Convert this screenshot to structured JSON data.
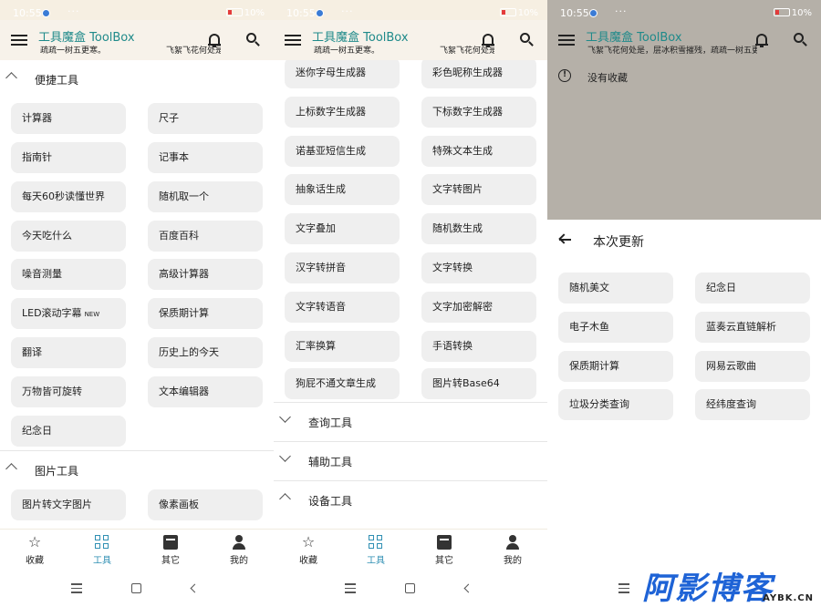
{
  "status": {
    "time": "10:55",
    "more": "···",
    "battery": "10%"
  },
  "app": {
    "title": "工具魔盒 ToolBox",
    "subtitle": "疏疏一树五更寒。",
    "subtitle2": "飞絮飞花何处是",
    "subtitle_overlay": "飞絮飞花何处是，层冰积雪摧残，疏疏一树五更寒"
  },
  "panel1": {
    "sections": [
      {
        "label": "便捷工具",
        "expanded": true,
        "items": [
          "计算器",
          "尺子",
          "指南针",
          "记事本",
          "每天60秒读懂世界",
          "随机取一个",
          "今天吃什么",
          "百度百科",
          "噪音测量",
          "高级计算器",
          "LED滚动字幕",
          "保质期计算",
          "翻译",
          "历史上的今天",
          "万物皆可旋转",
          "文本编辑器",
          "纪念日"
        ],
        "new_badge": "NEW"
      },
      {
        "label": "图片工具",
        "expanded": true,
        "items": [
          "图片转文字图片",
          "像素画板"
        ]
      }
    ]
  },
  "panel2": {
    "items": [
      "迷你字母生成器",
      "彩色昵称生成器",
      "上标数字生成器",
      "下标数字生成器",
      "诺基亚短信生成",
      "特殊文本生成",
      "抽象话生成",
      "文字转图片",
      "文字叠加",
      "随机数生成",
      "汉字转拼音",
      "文字转换",
      "文字转语音",
      "文字加密解密",
      "汇率换算",
      "手语转换",
      "狗屁不通文章生成",
      "图片转Base64"
    ],
    "sections": [
      {
        "label": "查询工具",
        "expanded": false
      },
      {
        "label": "辅助工具",
        "expanded": false
      },
      {
        "label": "设备工具",
        "expanded": true
      }
    ]
  },
  "nav": {
    "items": [
      {
        "label": "收藏",
        "icon": "star-icon",
        "active": false
      },
      {
        "label": "工具",
        "icon": "apps-icon",
        "active": true
      },
      {
        "label": "其它",
        "icon": "other-icon",
        "active": false
      },
      {
        "label": "我的",
        "icon": "person-icon",
        "active": false
      }
    ],
    "active_color": "#2f8fb3"
  },
  "panel3": {
    "empty_text": "没有收藏",
    "sheet_title": "本次更新",
    "updates": [
      "随机美文",
      "纪念日",
      "电子木鱼",
      "蓝奏云直链解析",
      "保质期计算",
      "网易云歌曲",
      "垃圾分类查询",
      "经纬度查询"
    ]
  },
  "watermark": {
    "big": "阿影博客",
    "small": "AYBK.CN"
  },
  "colors": {
    "accent": "#1f8a8a",
    "appbar": "#f7f2ea",
    "button": "#efefef"
  }
}
